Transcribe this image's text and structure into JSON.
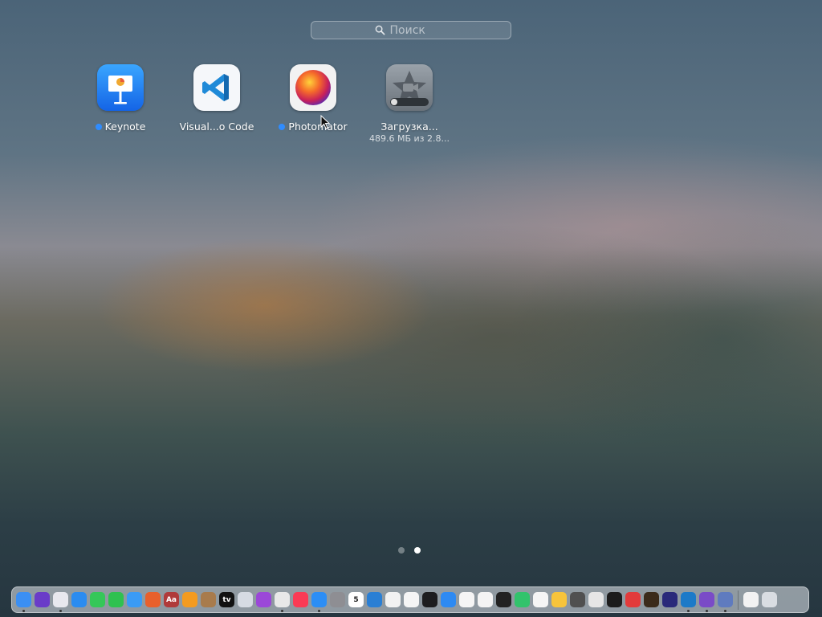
{
  "search": {
    "placeholder": "Поиск",
    "icon": "search-icon"
  },
  "apps": [
    {
      "name": "Keynote",
      "new_badge": true
    },
    {
      "name": "Visual...o Code",
      "new_badge": false
    },
    {
      "name": "Photomator",
      "new_badge": true
    },
    {
      "name": "Загрузка...",
      "progress_text": "489.6 МБ из 2.8...",
      "new_badge": false
    }
  ],
  "pages": {
    "count": 2,
    "current": 2
  },
  "dock": {
    "apps": [
      {
        "name": "finder",
        "color": "#3b8ff3",
        "running": true
      },
      {
        "name": "siri",
        "color": "#6a3cc8",
        "running": false
      },
      {
        "name": "launchpad",
        "color": "#e8e8ee",
        "running": true
      },
      {
        "name": "safari",
        "color": "#2b8cf0",
        "running": false
      },
      {
        "name": "messages",
        "color": "#35c759",
        "running": false
      },
      {
        "name": "facetime",
        "color": "#2fc150",
        "running": false
      },
      {
        "name": "mail",
        "color": "#3a9bf5",
        "running": false
      },
      {
        "name": "firefox",
        "color": "#e8602c",
        "running": false
      },
      {
        "name": "dictionary",
        "color": "#b03a3a",
        "glyph": "Aa",
        "running": false
      },
      {
        "name": "books",
        "color": "#f39b20",
        "running": false
      },
      {
        "name": "archive",
        "color": "#a87b4c",
        "running": false
      },
      {
        "name": "apple-tv",
        "color": "#111111",
        "glyph": "tv",
        "running": false
      },
      {
        "name": "vs-code-alt",
        "color": "#d6dbe3",
        "running": false
      },
      {
        "name": "podcasts",
        "color": "#9b48d8",
        "running": false
      },
      {
        "name": "chrome",
        "color": "#e8e8e8",
        "running": true
      },
      {
        "name": "music",
        "color": "#fa3b55",
        "running": false
      },
      {
        "name": "app-store",
        "color": "#2c8ef5",
        "running": true
      },
      {
        "name": "system-settings",
        "color": "#8e8e93",
        "running": false
      },
      {
        "name": "calendar",
        "color": "#ffffff",
        "glyph": "5",
        "running": false
      },
      {
        "name": "icloud",
        "color": "#2a7fd4",
        "running": false
      },
      {
        "name": "google-drive",
        "color": "#f2f2f2",
        "running": false
      },
      {
        "name": "photos",
        "color": "#f5f5f5",
        "running": false
      },
      {
        "name": "video-editor",
        "color": "#1d1d1f",
        "running": false
      },
      {
        "name": "keynote",
        "color": "#2d8af3",
        "running": false
      },
      {
        "name": "reminders",
        "color": "#f5f5f5",
        "running": false
      },
      {
        "name": "news",
        "color": "#f4f4f4",
        "running": false
      },
      {
        "name": "stocks",
        "color": "#222222",
        "running": false
      },
      {
        "name": "find-my",
        "color": "#32c36c",
        "running": false
      },
      {
        "name": "clock",
        "color": "#f5f5f5",
        "running": false
      },
      {
        "name": "home",
        "color": "#f7c43b",
        "running": false
      },
      {
        "name": "calculator",
        "color": "#505050",
        "running": false
      },
      {
        "name": "textedit",
        "color": "#e6e6e6",
        "running": false
      },
      {
        "name": "terminal",
        "color": "#1c1c1c",
        "running": false
      },
      {
        "name": "pdf-expert",
        "color": "#e23b3b",
        "running": false
      },
      {
        "name": "pixelmator",
        "color": "#3b2b1b",
        "running": false
      },
      {
        "name": "affinity",
        "color": "#2a2a7a",
        "running": false
      },
      {
        "name": "visual-studio-code",
        "color": "#1d7ac8",
        "running": true
      },
      {
        "name": "visual-studio",
        "color": "#7a4bc7",
        "running": true
      },
      {
        "name": "xcode-tool",
        "color": "#5f7bbf",
        "running": true
      }
    ],
    "trailing": [
      {
        "name": "downloads-stack",
        "color": "#f2f2f2",
        "running": false
      },
      {
        "name": "trash",
        "color": "#d9dde2",
        "running": false
      }
    ]
  }
}
